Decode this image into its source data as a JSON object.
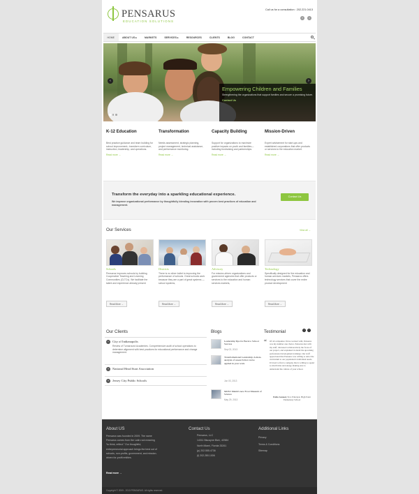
{
  "header": {
    "logo_name": "PENSARUS",
    "logo_tagline": "EDUCATION SOLUTIONS",
    "call_text": "Call us for a consultation : 202.221.0413",
    "social": [
      {
        "icon": "facebook-icon",
        "glyph": "f"
      },
      {
        "icon": "twitter-icon",
        "glyph": "t"
      }
    ]
  },
  "nav": {
    "items": [
      "HOME",
      "ABOUT US ▸",
      "MARKETS",
      "SERVICES ▸",
      "RESOURCES",
      "CLIENTS",
      "BLOG",
      "CONTACT"
    ]
  },
  "hero": {
    "title": "Empowering Children and Families",
    "description": "Strengthening the organizations that support families and secure a promising future.",
    "link": "Contact Us",
    "prev": "‹",
    "next": "›"
  },
  "features": [
    {
      "title": "K-12 Education",
      "text": "Best practice guidance and team building for school improvement– transform curriculum, instruction, leadership, and operations.",
      "more": "Read more →"
    },
    {
      "title": "Transformation",
      "text": "Needs assessment, strategic planning, project management, technical assistance, and performance monitoring.",
      "more": "Read more →"
    },
    {
      "title": "Capacity Building",
      "text": "Support for organizations to maximize positive impacts on youth and families—including fundraising and partnerships.",
      "more": "Read more →"
    },
    {
      "title": "Mission-Driven",
      "text": "Expert advisement for start-ups and established corporations that offer products or services to the education market.",
      "more": "Read more →"
    }
  ],
  "cta": {
    "title": "Transform the everyday into a sparkling educational experience.",
    "text": "We improve organizational performance by thoughtfully blending innovation with proven best practices of education and management.",
    "button": "Contact Us"
  },
  "services": {
    "title": "Our Services",
    "view_all": "View all →",
    "items": [
      {
        "title": "Schools",
        "text": "Pensarus improves schools by building Cooperative Teaching and Learning Communities (CLTCs). We facilitate the talent and experience already present",
        "button": "Read More →"
      },
      {
        "title": "Districts",
        "text": "There is no silver bullet to improving the performance of schools. Great schools work because they are a part of great systems — school systems,",
        "button": "Read More →"
      },
      {
        "title": "Advisory",
        "text": "For mission-driven organizations and government agencies that offer products or services to the education and human services markets,",
        "button": "Read More →"
      },
      {
        "title": "Technology",
        "text": "Specifically designed for the education and human-services markets, Pensarus offers technology services that cover the entire product development",
        "button": "Read More →"
      }
    ]
  },
  "clients": {
    "title": "Our Clients",
    "items": [
      {
        "name": "City of Indianapolis",
        "desc": "Review of Turnaround Academies. Comprehensive audit of school operations to determine alignment with best practices for educational performance and change management.",
        "icon": "−"
      },
      {
        "name": "National Head Start Association",
        "icon": "+"
      },
      {
        "name": "Jersey City Public Schools",
        "icon": "+"
      }
    ]
  },
  "blogs": {
    "title": "Blogs",
    "items": [
      {
        "title": "Leadership Tips for Back to School Success",
        "date": "Sep 03, 2013"
      },
      {
        "title": "Transformational Leadership: A meta-analysis of research that can be applied in your work",
        "date": "Jun 03, 2013"
      },
      {
        "title": "MOSI: Miami's new Frost Museum of Science",
        "date": "May 29, 2013"
      }
    ]
  },
  "testimonial": {
    "title": "Testimonial",
    "quote": "Of all companies I have worked with, Pensarus was my number one choice. Pensarus met with my staff, discussed collaboratively the focus of our project, and explained in detail the upcoming professional development trainings. Our staff appreciated that Pensarus was willing to tailor the curriculum to our population's individual needs. It's hard to find a company that is willing to spend so much time and energy making sure to understand the culture of your school.",
    "author_name": "Pablo Samuel,",
    "author_role": "Vice Principal, High Point Elementary School"
  },
  "footer": {
    "about_title": "About US",
    "about_text": [
      "Pensarus was founded in 2009. The name",
      "Pensarus comes from the Latin root meaning",
      "“to think, reflect.” Our thoughtful,",
      "entrepreneurial approach brings the best out of",
      "schools, non-profits, government, and mission-",
      "driven for-profit entities."
    ],
    "about_more": "Read more →",
    "contact_title": "Contact Us",
    "contact_lines": [
      "Pensarus, LLC",
      "14311 Biscayne Blvd., #2584",
      "North Miami, Florida 33261",
      "(p) 202.555.4736",
      "(f) 202.280.1006"
    ],
    "links_title": "Additional Links",
    "links": [
      "Privacy",
      "Terms & Conditions",
      "Sitemap"
    ],
    "copyright": "Copyright © 2009 - 2013 PENSARUS. All rights reserved."
  }
}
